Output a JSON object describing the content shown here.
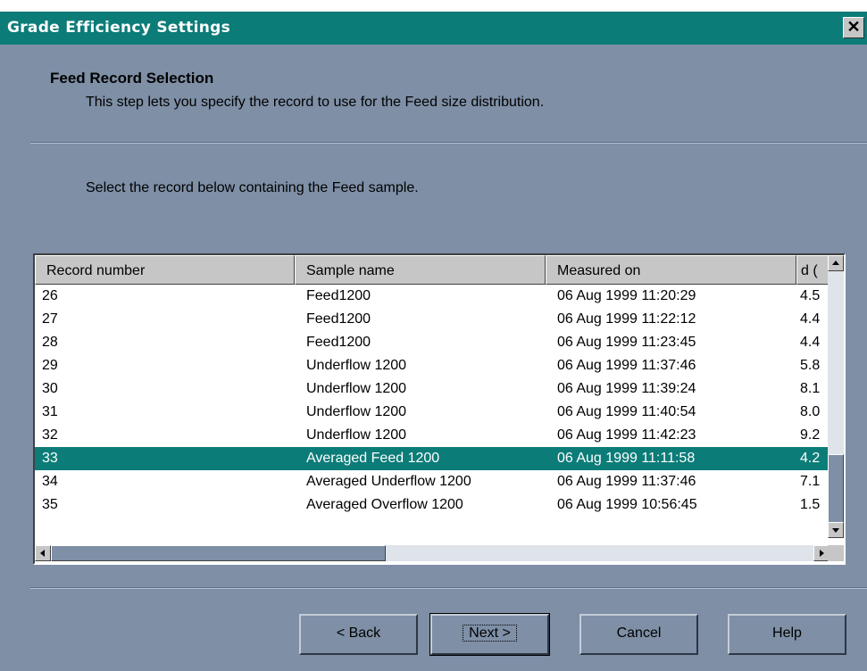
{
  "window": {
    "title": "Grade Efficiency Settings",
    "close_glyph": "✕"
  },
  "header": {
    "title": "Feed Record Selection",
    "subtitle": "This step lets you specify the record to use for the Feed size distribution."
  },
  "instruction": "Select the record below containing the Feed sample.",
  "list": {
    "columns": [
      "Record number",
      "Sample name",
      "Measured on",
      "d ("
    ],
    "rows": [
      {
        "record": "26",
        "name": "Feed1200",
        "measured": "06 Aug 1999 11:20:29",
        "d": "4.5"
      },
      {
        "record": "27",
        "name": "Feed1200",
        "measured": "06 Aug 1999 11:22:12",
        "d": "4.4"
      },
      {
        "record": "28",
        "name": "Feed1200",
        "measured": "06 Aug 1999 11:23:45",
        "d": "4.4"
      },
      {
        "record": "29",
        "name": "Underflow 1200",
        "measured": "06 Aug 1999 11:37:46",
        "d": "5.8"
      },
      {
        "record": "30",
        "name": "Underflow 1200",
        "measured": "06 Aug 1999 11:39:24",
        "d": "8.1"
      },
      {
        "record": "31",
        "name": "Underflow 1200",
        "measured": "06 Aug 1999 11:40:54",
        "d": "8.0"
      },
      {
        "record": "32",
        "name": "Underflow 1200",
        "measured": "06 Aug 1999 11:42:23",
        "d": "9.2"
      },
      {
        "record": "33",
        "name": "Averaged Feed 1200",
        "measured": "06 Aug 1999 11:11:58",
        "d": "4.2"
      },
      {
        "record": "34",
        "name": "Averaged Underflow 1200",
        "measured": "06 Aug 1999 11:37:46",
        "d": "7.1"
      },
      {
        "record": "35",
        "name": "Averaged Overflow 1200",
        "measured": "06 Aug 1999 10:56:45",
        "d": "1.5"
      }
    ],
    "selected_record": "33"
  },
  "buttons": {
    "back": "< Back",
    "next": "Next >",
    "cancel": "Cancel",
    "help": "Help"
  },
  "colors": {
    "title_bar": "#0c7c78",
    "dialog_bg": "#7e8fa6",
    "selection": "#0c7c78"
  }
}
